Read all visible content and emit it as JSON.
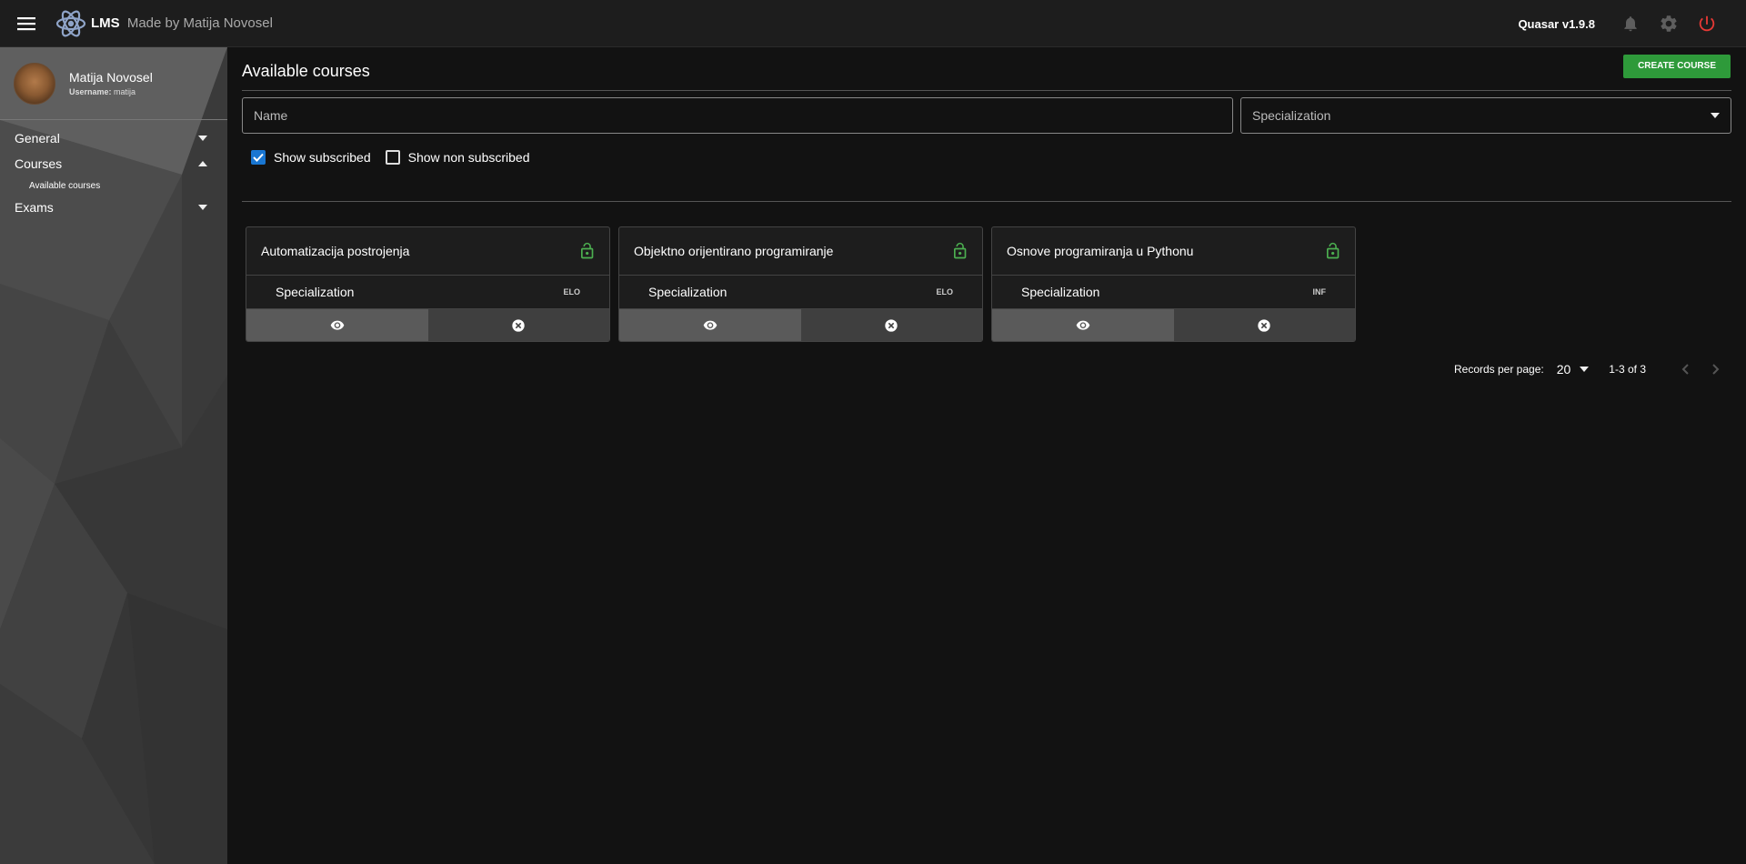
{
  "header": {
    "brand": "LMS",
    "subtitle": "Made by Matija Novosel",
    "version": "Quasar v1.9.8",
    "icons": [
      "menu-icon",
      "atom-logo-icon",
      "bell-icon",
      "gear-icon",
      "power-icon"
    ],
    "power_color": "#e53935"
  },
  "sidebar": {
    "profile": {
      "name": "Matija Novosel",
      "username_label": "Username:",
      "username": "matija"
    },
    "items": [
      {
        "label": "General",
        "expanded": false
      },
      {
        "label": "Courses",
        "expanded": true,
        "children": [
          {
            "label": "Available courses"
          }
        ]
      },
      {
        "label": "Exams",
        "expanded": false
      }
    ]
  },
  "main": {
    "title": "Available courses",
    "create_button": "CREATE COURSE",
    "name_placeholder": "Name",
    "specialization_placeholder": "Specialization",
    "show_subscribed": {
      "label": "Show subscribed",
      "checked": true
    },
    "show_non_subscribed": {
      "label": "Show non subscribed",
      "checked": false
    },
    "courses": [
      {
        "name": "Automatizacija postrojenja",
        "spec_label": "Specialization",
        "spec_code": "ELO"
      },
      {
        "name": "Objektno orijentirano programiranje",
        "spec_label": "Specialization",
        "spec_code": "ELO"
      },
      {
        "name": "Osnove programiranja u Pythonu",
        "spec_label": "Specialization",
        "spec_code": "INF"
      }
    ],
    "pagination": {
      "records_label": "Records per page:",
      "per_page": "20",
      "range": "1-3 of 3"
    }
  },
  "colors": {
    "accent_green": "#2e9a3a",
    "lock_green": "#4caf50",
    "checkbox_blue": "#1976d2"
  }
}
